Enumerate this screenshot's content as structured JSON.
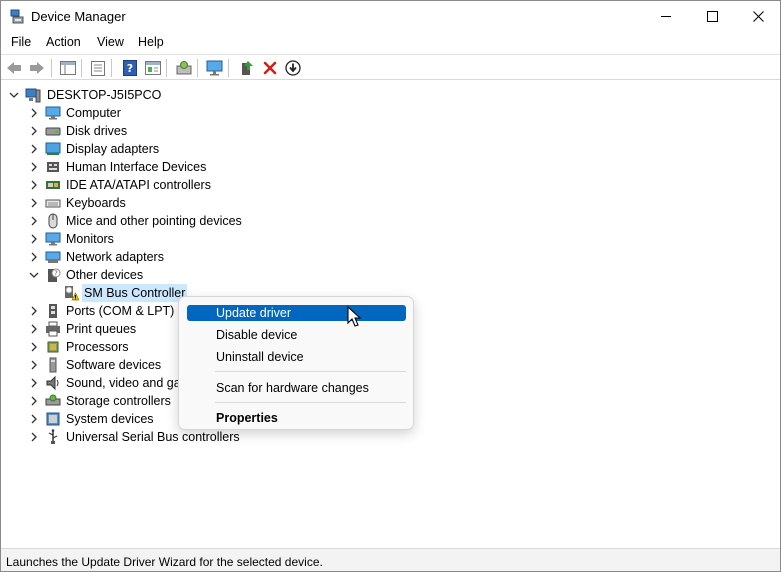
{
  "window": {
    "title": "Device Manager"
  },
  "menubar": {
    "items": [
      "File",
      "Action",
      "View",
      "Help"
    ]
  },
  "tree": {
    "root": "DESKTOP-J5I5PCO",
    "categories": [
      {
        "label": "Computer",
        "icon": "computer-icon"
      },
      {
        "label": "Disk drives",
        "icon": "disk-drive-icon"
      },
      {
        "label": "Display adapters",
        "icon": "display-adapter-icon"
      },
      {
        "label": "Human Interface Devices",
        "icon": "hid-icon"
      },
      {
        "label": "IDE ATA/ATAPI controllers",
        "icon": "ide-controller-icon"
      },
      {
        "label": "Keyboards",
        "icon": "keyboard-icon"
      },
      {
        "label": "Mice and other pointing devices",
        "icon": "mouse-icon"
      },
      {
        "label": "Monitors",
        "icon": "monitor-icon"
      },
      {
        "label": "Network adapters",
        "icon": "network-adapter-icon"
      },
      {
        "label": "Other devices",
        "icon": "other-devices-icon"
      },
      {
        "label": "SM Bus Controller",
        "icon": "warning-device-icon"
      },
      {
        "label": "Ports (COM & LPT)",
        "icon": "port-icon"
      },
      {
        "label": "Print queues",
        "icon": "printer-icon"
      },
      {
        "label": "Processors",
        "icon": "processor-icon"
      },
      {
        "label": "Software devices",
        "icon": "software-device-icon"
      },
      {
        "label": "Sound, video and gar",
        "icon": "sound-icon"
      },
      {
        "label": "Storage controllers",
        "icon": "storage-controller-icon"
      },
      {
        "label": "System devices",
        "icon": "system-device-icon"
      },
      {
        "label": "Universal Serial Bus controllers",
        "icon": "usb-icon"
      }
    ]
  },
  "context_menu": {
    "items": [
      "Update driver",
      "Disable device",
      "Uninstall device",
      "Scan for hardware changes",
      "Properties"
    ],
    "highlighted": "Update driver"
  },
  "statusbar": {
    "text": "Launches the Update Driver Wizard for the selected device."
  },
  "colors": {
    "accent": "#0067c0",
    "selection": "#cce8ff",
    "delete_red": "#d0201a",
    "green": "#2e9e3e"
  }
}
